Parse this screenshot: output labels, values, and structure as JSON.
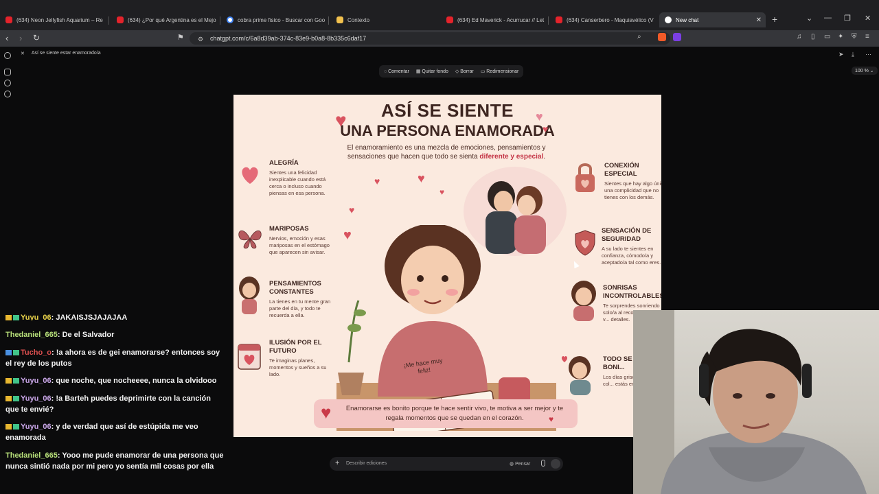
{
  "browser": {
    "tabs": [
      {
        "title": "(634) Neon Jellyfish Aquarium – Re",
        "icon": "youtube-icon"
      },
      {
        "title": "(634) ¿Por qué Argentina es el Mejo",
        "icon": "youtube-icon"
      },
      {
        "title": "cobra prime fisico - Buscar con Goo",
        "icon": "google-icon"
      },
      {
        "title": "Contexto",
        "icon": "document-icon"
      },
      {
        "title": "(634) Ed Maverick - Acurrucar // Let",
        "icon": "youtube-icon"
      },
      {
        "title": "(634) Canserbero - Maquiavélico (V",
        "icon": "youtube-icon"
      },
      {
        "title": "New chat",
        "icon": "chatgpt-icon",
        "active": true
      }
    ],
    "url": "chatgpt.com/c/6a8d39ab-374c-83e9-b0a8-8b335c6daf17"
  },
  "editor": {
    "image_title": "Así se siente estar enamorado/a",
    "tools": [
      "Comentar",
      "Quitar fondo",
      "Borrar",
      "Redimensionar"
    ],
    "zoom": "100 %",
    "prompt_placeholder": "Describir ediciones",
    "think_label": "Pensar"
  },
  "infographic": {
    "title_line1": "ASÍ SE SIENTE",
    "title_line2": "UNA PERSONA ENAMORADA",
    "subtitle_start": "El enamoramiento es una mezcla de emociones, pensamientos y sensaciones que hacen que todo se sienta",
    "subtitle_highlight": "diferente y especial",
    "subtitle_end": ".",
    "left_features": [
      {
        "title": "ALEGRÍA",
        "desc": "Sientes una felicidad inexplicable cuando está cerca o incluso cuando piensas en esa persona."
      },
      {
        "title": "MARIPOSAS",
        "desc": "Nervios, emoción y esas mariposas en el estómago que aparecen sin avisar."
      },
      {
        "title": "PENSAMIENTOS CONSTANTES",
        "desc": "La tienes en tu mente gran parte del día, y todo te recuerda a ella."
      },
      {
        "title": "ILUSIÓN POR EL FUTURO",
        "desc": "Te imaginas planes, momentos y sueños a su lado."
      }
    ],
    "right_features": [
      {
        "title": "CONEXIÓN ESPECIAL",
        "desc": "Sientes que hay algo único, una complicidad que no tienes con los demás."
      },
      {
        "title": "SENSACIÓN DE SEGURIDAD",
        "desc": "A su lado te sientes en confianza, cómodo/a y aceptado/a tal como eres."
      },
      {
        "title": "SONRISAS INCONTROLABLES",
        "desc": "Te sorprendes sonriendo solo/a al reco... mensajes, su v... detalles."
      },
      {
        "title": "TODO SE V... MÁS BONI...",
        "desc": "Los días grise... tener más col... estás enamor..."
      }
    ],
    "notebook_text": "¡Me hace muy feliz!",
    "banner": "Enamorarse es bonito porque te hace sentir vivo, te motiva a ser mejor y te regala momentos que se quedan en el corazón."
  },
  "chat": [
    {
      "user": "Yuyu_06",
      "text": "JAKAISJSJAJAJAA",
      "color": "#e8d24a"
    },
    {
      "user": "Thedaniel_665",
      "text": "De el Salvador",
      "color": "#b8e07a"
    },
    {
      "user": "Tucho_o",
      "text": "!a ahora es de gei enamorarse? entonces soy el rey de los putos",
      "color": "#e05050"
    },
    {
      "user": "Yuyu_06",
      "text": "que noche, que nocheeee, nunca la olvidooo",
      "color": "#c9a6e8"
    },
    {
      "user": "Yuyu_06",
      "text": "!a Barteh puedes deprimirte con la canción que te envié?",
      "color": "#c9a6e8"
    },
    {
      "user": "Yuyu_06",
      "text": "y de verdad que así de estúpida me veo enamorada",
      "color": "#c9a6e8"
    },
    {
      "user": "Thedaniel_665",
      "text": "Yooo me pude enamorar de una persona que nunca sintió nada por mi pero yo sentía mil cosas por ella",
      "color": "#b8e07a"
    }
  ]
}
